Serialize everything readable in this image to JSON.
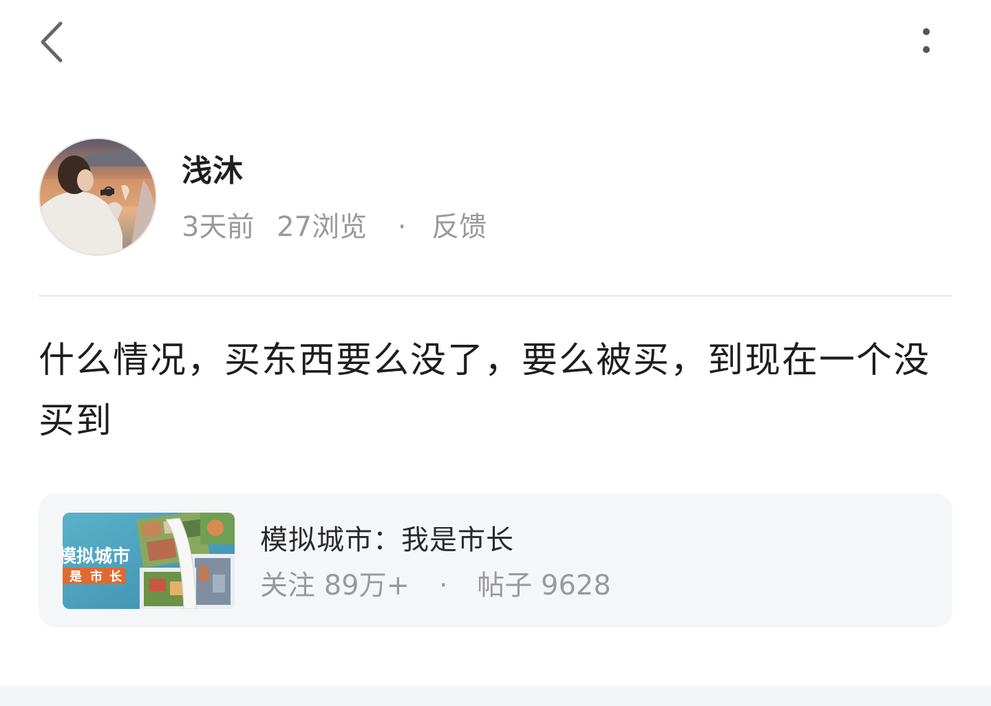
{
  "topbar": {
    "back_icon": "chevron-left-icon",
    "more_icon": "more-vertical-icon"
  },
  "post": {
    "author_name": "浅沐",
    "time_ago": "3天前",
    "views": "27浏览",
    "separator": "·",
    "feedback_label": "反馈",
    "content": "什么情况，买东西要么没了，要么被买，到现在一个没买到"
  },
  "forum": {
    "name": "模拟城市：我是市长",
    "followers": "关注 89万+",
    "separator": "·",
    "posts": "帖子 9628",
    "logo_line1": "模拟城市",
    "logo_line2": [
      "是",
      "市",
      "长"
    ]
  },
  "colors": {
    "text_primary": "#1e1e1e",
    "text_secondary": "#999999",
    "card_bg": "#f5f6f8",
    "divider": "#e8e8e8"
  }
}
